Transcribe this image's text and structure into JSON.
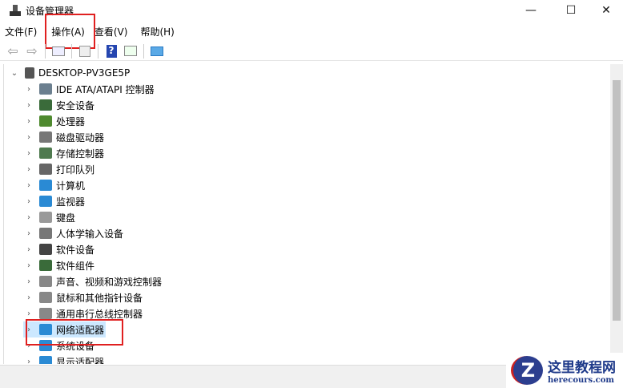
{
  "window": {
    "title": "设备管理器",
    "min": "—",
    "max": "☐",
    "close": "✕"
  },
  "menu": [
    "文件(F)",
    "操作(A)",
    "查看(V)",
    "帮助(H)"
  ],
  "toolbar": [
    "back-icon",
    "forward-icon",
    "show-hide-tree-icon",
    "properties-icon",
    "help-icon",
    "action-pane-icon",
    "scan-hardware-icon"
  ],
  "tree": {
    "root": "DESKTOP-PV3GE5P",
    "items": [
      {
        "label": "IDE ATA/ATAPI 控制器",
        "color": "#6b7f8f"
      },
      {
        "label": "安全设备",
        "color": "#3a6b3a"
      },
      {
        "label": "处理器",
        "color": "#4f8a2f"
      },
      {
        "label": "磁盘驱动器",
        "color": "#777777"
      },
      {
        "label": "存储控制器",
        "color": "#4f7a4f"
      },
      {
        "label": "打印队列",
        "color": "#666666"
      },
      {
        "label": "计算机",
        "color": "#2a8ad4"
      },
      {
        "label": "监视器",
        "color": "#2a8ad4"
      },
      {
        "label": "键盘",
        "color": "#999999"
      },
      {
        "label": "人体学输入设备",
        "color": "#777777"
      },
      {
        "label": "软件设备",
        "color": "#444444"
      },
      {
        "label": "软件组件",
        "color": "#3a6b3a"
      },
      {
        "label": "声音、视频和游戏控制器",
        "color": "#888888"
      },
      {
        "label": "鼠标和其他指针设备",
        "color": "#888888"
      },
      {
        "label": "通用串行总线控制器",
        "color": "#888888"
      },
      {
        "label": "网络适配器",
        "color": "#2a8ad4"
      },
      {
        "label": "系统设备",
        "color": "#2a8ad4"
      },
      {
        "label": "显示适配器",
        "color": "#2a8ad4"
      }
    ]
  },
  "watermark": {
    "name": "这里教程网",
    "url": "herecours.com"
  },
  "highlight": "#e02020"
}
